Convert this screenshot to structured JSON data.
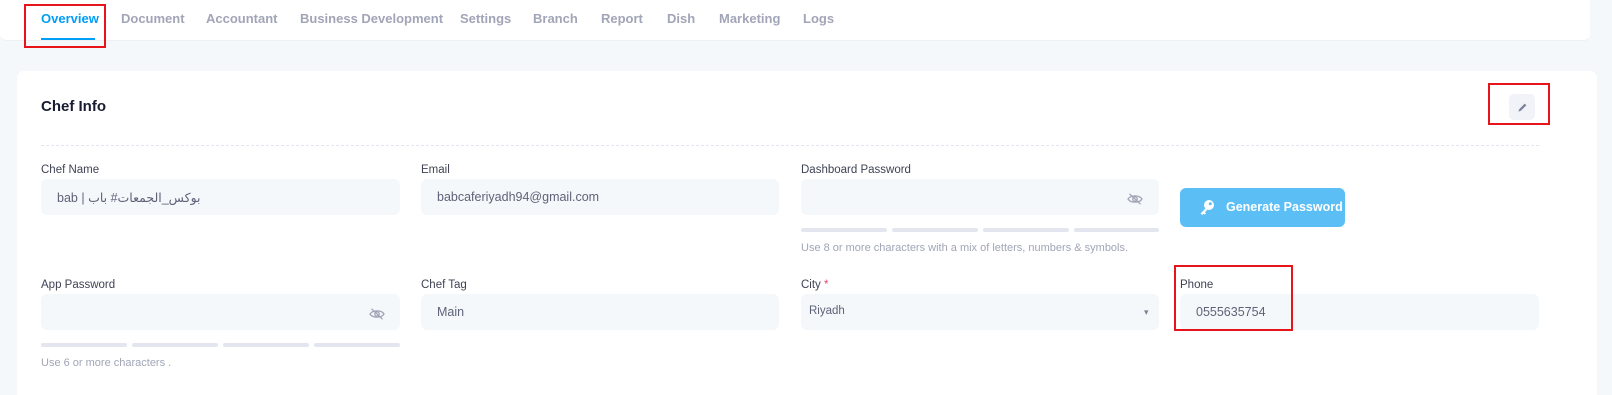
{
  "tabs": [
    {
      "label": "Overview",
      "active": true
    },
    {
      "label": "Document"
    },
    {
      "label": "Accountant"
    },
    {
      "label": "Business Development"
    },
    {
      "label": "Settings"
    },
    {
      "label": "Branch"
    },
    {
      "label": "Report"
    },
    {
      "label": "Dish"
    },
    {
      "label": "Marketing"
    },
    {
      "label": "Logs"
    }
  ],
  "card": {
    "title": "Chef Info"
  },
  "form": {
    "chef_name": {
      "label": "Chef Name",
      "value": "bab | بوكس_الجمعات# باب"
    },
    "email": {
      "label": "Email",
      "value": "babcaferiyadh94@gmail.com"
    },
    "dashboard_password": {
      "label": "Dashboard Password",
      "value": "",
      "hint": "Use 8 or more characters with a mix of letters, numbers & symbols."
    },
    "generate_button": "Generate Password",
    "app_password": {
      "label": "App Password",
      "value": "",
      "hint": "Use 6 or more characters ."
    },
    "chef_tag": {
      "label": "Chef Tag",
      "value": "Main"
    },
    "city": {
      "label": "City",
      "required_mark": "*",
      "selected": "Riyadh"
    },
    "phone": {
      "label": "Phone",
      "value": "0555635754"
    }
  },
  "colors": {
    "accent": "#009ef7",
    "generate_button": "#5bbff5",
    "highlight": "#e8141b",
    "required": "#f1416c"
  }
}
